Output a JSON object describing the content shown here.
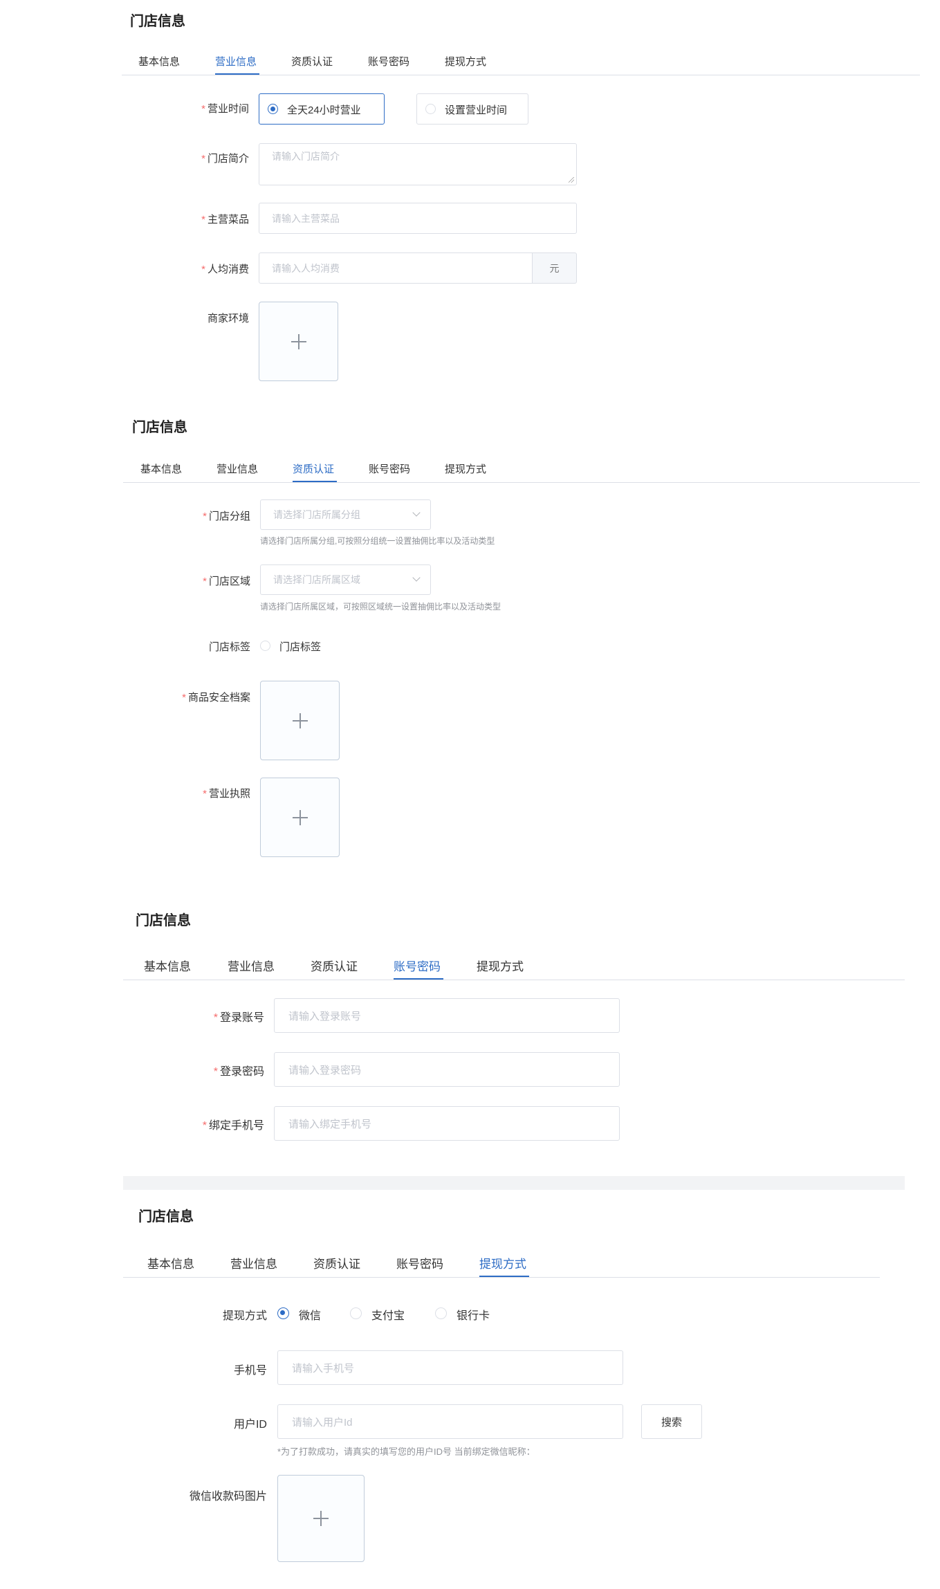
{
  "section_title": "门店信息",
  "tabs": [
    "基本信息",
    "营业信息",
    "资质认证",
    "账号密码",
    "提现方式"
  ],
  "panel1": {
    "hours_label": "营业时间",
    "hours_option_all_day": "全天24小时营业",
    "hours_option_custom": "设置营业时间",
    "intro_label": "门店简介",
    "intro_placeholder": "请输入门店简介",
    "dishes_label": "主营菜品",
    "dishes_placeholder": "请输入主营菜品",
    "avg_label": "人均消费",
    "avg_placeholder": "请输入人均消费",
    "avg_unit": "元",
    "env_label": "商家环境"
  },
  "panel2": {
    "group_label": "门店分组",
    "group_placeholder": "请选择门店所属分组",
    "group_hint": "请选择门店所属分组,可按照分组统一设置抽佣比率以及活动类型",
    "area_label": "门店区域",
    "area_placeholder": "请选择门店所属区域",
    "area_hint": "请选择门店所属区域，可按照区域统一设置抽佣比率以及活动类型",
    "tag_label": "门店标签",
    "tag_option": "门店标签",
    "safety_label": "商品安全档案",
    "license_label": "营业执照"
  },
  "panel3": {
    "account_label": "登录账号",
    "account_placeholder": "请输入登录账号",
    "password_label": "登录密码",
    "password_placeholder": "请输入登录密码",
    "phone_label": "绑定手机号",
    "phone_placeholder": "请输入绑定手机号"
  },
  "panel4": {
    "method_label": "提现方式",
    "method_wechat": "微信",
    "method_alipay": "支付宝",
    "method_bank": "银行卡",
    "phone_label": "手机号",
    "phone_placeholder": "请输入手机号",
    "userid_label": "用户ID",
    "userid_placeholder": "请输入用户Id",
    "search_button": "搜索",
    "userid_hint": "*为了打款成功，请真实的填写您的用户ID号 当前绑定微信昵称：",
    "qrcode_label": "微信收款码图片"
  },
  "colors": {
    "accent": "#2d6cc5",
    "required": "#f56c6c",
    "border": "#dcdfe6",
    "placeholder": "#c0c4cc"
  }
}
